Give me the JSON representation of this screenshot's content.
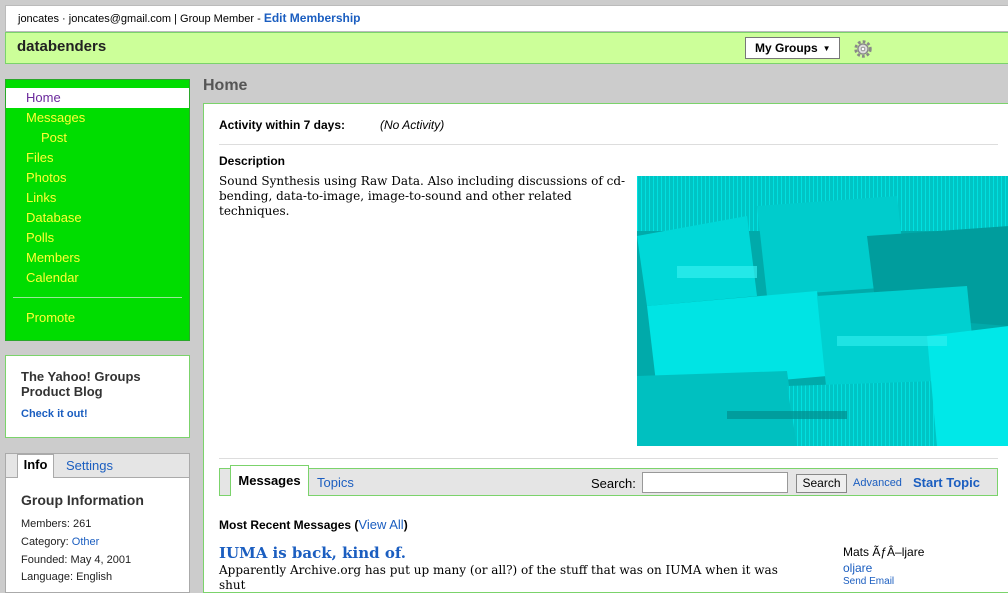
{
  "userbar": {
    "username": "joncates",
    "email": "joncates@gmail.com",
    "role": "Group Member",
    "edit_link": "Edit Membership"
  },
  "group": {
    "name": "databenders",
    "my_groups_label": "My Groups"
  },
  "nav": {
    "items": [
      {
        "label": "Home"
      },
      {
        "label": "Messages"
      },
      {
        "label": "Post"
      },
      {
        "label": "Files"
      },
      {
        "label": "Photos"
      },
      {
        "label": "Links"
      },
      {
        "label": "Database"
      },
      {
        "label": "Polls"
      },
      {
        "label": "Members"
      },
      {
        "label": "Calendar"
      },
      {
        "label": "Promote"
      }
    ],
    "colors": {
      "bg": "#00dd00",
      "text": "#ffff33",
      "active": "#6b2a9c"
    }
  },
  "promo": {
    "title": "The Yahoo! Groups Product Blog",
    "link": "Check it out!"
  },
  "info_panel": {
    "tab_info": "Info",
    "tab_settings": "Settings",
    "heading": "Group Information",
    "members_label": "Members:",
    "members_value": "261",
    "category_label": "Category:",
    "category_value": "Other",
    "founded_label": "Founded:",
    "founded_value": "May 4, 2001",
    "language_label": "Language:",
    "language_value": "English"
  },
  "main": {
    "title": "Home",
    "activity_label": "Activity within 7 days:",
    "activity_value": "(No Activity)",
    "description_label": "Description",
    "description_text": "Sound Synthesis using Raw Data. Also including discussions of cd-bending, data-to-image, image-to-sound and other related techniques."
  },
  "messages_bar": {
    "tab_messages": "Messages",
    "tab_topics": "Topics",
    "search_label": "Search:",
    "search_value": "",
    "search_button": "Search",
    "advanced": "Advanced",
    "start_topic": "Start Topic"
  },
  "recent": {
    "heading": "Most Recent Messages",
    "view_all": "View All",
    "message": {
      "title": "IUMA is back, kind of.",
      "snippet": "Apparently Archive.org has put up many (or all?) of the stuff that was on IUMA when it was shut",
      "author": "Mats ÃƒÂ–ljare",
      "author_id": "oljare",
      "send_email": "Send Email"
    }
  }
}
